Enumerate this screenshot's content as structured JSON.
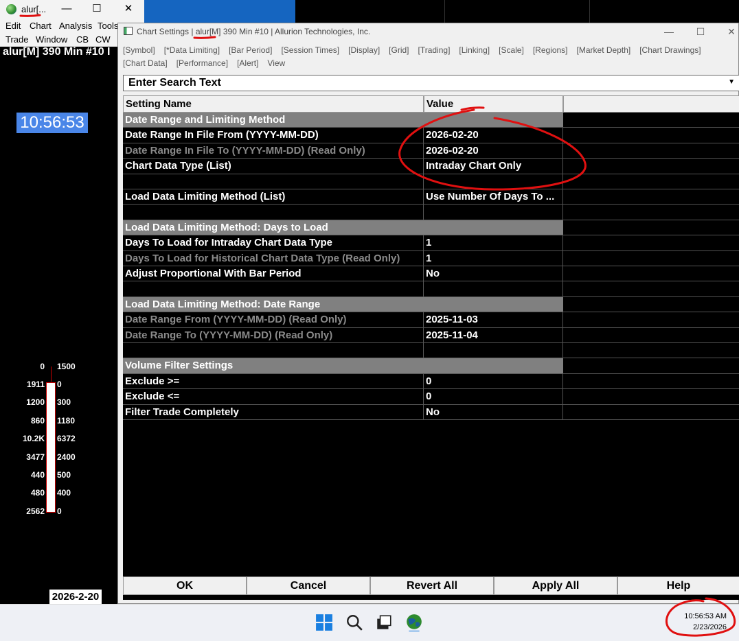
{
  "main_window": {
    "title": "alur[...",
    "menu_row1": [
      "Edit",
      "Chart",
      "Analysis",
      "Tools"
    ],
    "menu_row2": [
      "Trade",
      "Window",
      "CB",
      "CW"
    ],
    "chart_title": "alur[M]  390 Min  #10 I",
    "clock": "10:56:53",
    "dom_top_left": "0",
    "dom_top_right": "1500",
    "dom_rows": [
      {
        "bid": "1911",
        "ask": "0"
      },
      {
        "bid": "1200",
        "ask": "300"
      },
      {
        "bid": "860",
        "ask": "1180"
      },
      {
        "bid": "10.2K",
        "ask": "6372"
      },
      {
        "bid": "3477",
        "ask": "2400"
      },
      {
        "bid": "440",
        "ask": "500"
      },
      {
        "bid": "480",
        "ask": "400"
      },
      {
        "bid": "2562",
        "ask": "0"
      }
    ],
    "date": "2026-2-20"
  },
  "dialog": {
    "title": "Chart Settings | alur[M]  390 Min  #10 | Allurion Technologies, Inc.",
    "tabs": [
      "[Symbol]",
      "[*Data Limiting]",
      "[Bar Period]",
      "[Session Times]",
      "[Display]",
      "[Grid]",
      "[Trading]",
      "[Linking]",
      "[Scale]",
      "[Regions]",
      "[Market Depth]",
      "[Chart Drawings]",
      "[Chart Data]",
      "[Performance]",
      "[Alert]",
      "View"
    ],
    "search_placeholder": "Enter Search Text",
    "col_setting": "Setting Name",
    "col_value": "Value",
    "rows": [
      {
        "type": "section",
        "name": "Date Range and Limiting Method",
        "value": ""
      },
      {
        "type": "item",
        "name": "Date Range In File From (YYYY-MM-DD)",
        "value": "2026-02-20"
      },
      {
        "type": "readonly",
        "name": "Date Range In File To (YYYY-MM-DD) (Read Only)",
        "value": "2026-02-20"
      },
      {
        "type": "item",
        "name": "Chart Data Type (List)",
        "value": "Intraday Chart Only"
      },
      {
        "type": "blank",
        "name": "",
        "value": ""
      },
      {
        "type": "item",
        "name": "Load Data Limiting Method (List)",
        "value": "Use Number Of Days To ..."
      },
      {
        "type": "blank",
        "name": "",
        "value": ""
      },
      {
        "type": "section",
        "name": "Load Data Limiting Method: Days to Load",
        "value": ""
      },
      {
        "type": "item",
        "name": "Days To Load for Intraday Chart Data Type",
        "value": "1"
      },
      {
        "type": "readonly",
        "name": "Days To Load for Historical Chart Data Type (Read Only)",
        "value": "1"
      },
      {
        "type": "item",
        "name": "Adjust Proportional With Bar Period",
        "value": "No"
      },
      {
        "type": "blank",
        "name": "",
        "value": ""
      },
      {
        "type": "section",
        "name": "Load Data Limiting Method: Date Range",
        "value": ""
      },
      {
        "type": "readonly",
        "name": "Date Range From (YYYY-MM-DD) (Read Only)",
        "value": "2025-11-03"
      },
      {
        "type": "readonly",
        "name": "Date Range To (YYYY-MM-DD) (Read Only)",
        "value": "2025-11-04"
      },
      {
        "type": "blank",
        "name": "",
        "value": ""
      },
      {
        "type": "section",
        "name": "Volume Filter Settings",
        "value": ""
      },
      {
        "type": "item",
        "name": "Exclude >=",
        "value": "0"
      },
      {
        "type": "item",
        "name": "Exclude <=",
        "value": "0"
      },
      {
        "type": "item",
        "name": "Filter Trade Completely",
        "value": "No"
      }
    ],
    "buttons": {
      "ok": "OK",
      "cancel": "Cancel",
      "revert": "Revert All",
      "apply": "Apply All",
      "help": "Help"
    }
  },
  "taskbar": {
    "time": "10:56:53 AM",
    "date": "2/23/2026"
  },
  "colors": {
    "annotation": "#e01010",
    "section_bg": "#808080",
    "clock_bg": "#4a86e8"
  }
}
